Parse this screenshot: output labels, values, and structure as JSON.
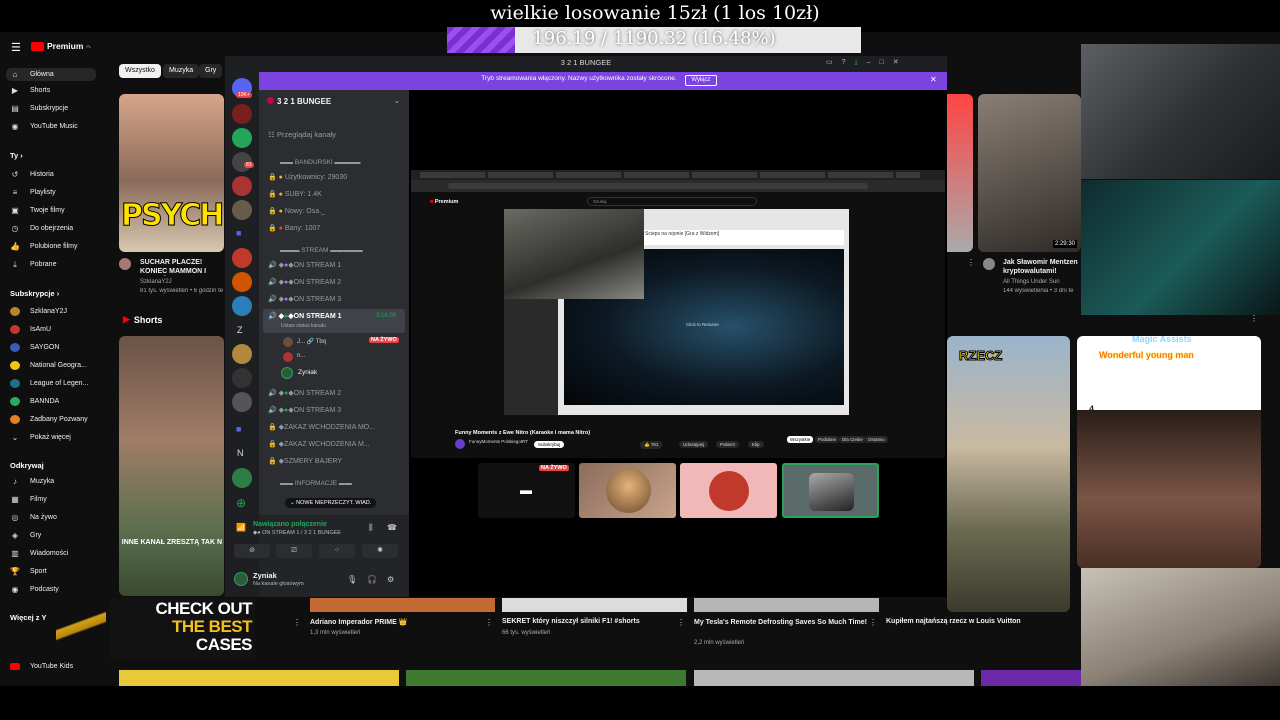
{
  "banner": {
    "title": "wielkie losowanie 15zł (1 los 10zł)",
    "goal_text": "196.19 / 1190.32 (16.48%)",
    "goal_progress": 0.1648
  },
  "youtube": {
    "brand": "Premium",
    "brand_sup": "PL",
    "nav": [
      "Główna",
      "Shorts",
      "Subskrypcje",
      "YouTube Music"
    ],
    "you_header": "Ty",
    "you_items": [
      "Historia",
      "Playlisty",
      "Twoje filmy",
      "Do obejrzenia",
      "Polubione filmy",
      "Pobrane"
    ],
    "subs_header": "Subskrypcje",
    "subs": [
      "SzklanaY2J",
      "IsAmU",
      "SAYGON",
      "National Geogra...",
      "League of Legen...",
      "BANNDA",
      "Zadbany Pozwany",
      "Pokaż więcej"
    ],
    "explore_header": "Odkrywaj",
    "explore": [
      "Muzyka",
      "Filmy",
      "Na żywo",
      "Gry",
      "Wiadomości",
      "Sport",
      "Podcasty"
    ],
    "more_header": "Więcej z Y",
    "more_items": [
      "YouTube Kids"
    ],
    "chips": [
      "Wszystko",
      "Muzyka",
      "Gry"
    ],
    "shorts_label": "Shorts",
    "videos": [
      {
        "title": "SUCHAR PLACZE! KONIEC MAMMON I POWRÓT HON",
        "channel": "SzklanaY2J",
        "meta": "81 tys. wyświetleń • 6 godzin te",
        "thumb_text": "PSYCH"
      },
      {
        "title": "Jak Sławomir Mentzen kryptowalutami!",
        "channel": "All Things Under Sun",
        "meta": "144 wyświetlenia • 3 dni te"
      }
    ],
    "short_thumb_text": "INNE KANAŁ ZRESZTĄ TAK N",
    "bottom_videos": [
      {
        "title": "Adriano Imperador PRIME 👑",
        "meta": "1,3 mln wyświetleń"
      },
      {
        "title": "SEKRET który niszczył silniki F1! #shorts",
        "meta": "66 tys. wyświetleń"
      },
      {
        "title": "My Tesla's Remote Defrosting Saves So Much Time!",
        "meta": "2,2 mln wyświetleń"
      },
      {
        "title": "Kupiłem najtańszą rzecz w Louis Vuitton",
        "meta": ""
      }
    ],
    "short_overlay_rzecz": "RZECZ",
    "magic_title": "Magic Assists",
    "magic_line": "Wonderful young man",
    "magic_count": "4",
    "duration_badge": "2:29:30"
  },
  "discord": {
    "window_title": "3 2 1 BUNGEE",
    "notice": "Tryb streamowania włączony. Nazwy użytkownika zostały skrócone.",
    "notice_button": "Wyłącz",
    "server_name": "3 2 1 BUNGEE",
    "browse": "Przeglądaj kanały",
    "cat_bandurski": "BANDURSKI",
    "info_channels": [
      "Użytkownicy: 29030",
      "SUBY: 1.4K",
      "Nowy: Osa._",
      "Bany: 1007"
    ],
    "cat_stream": "STREAM",
    "stream_channels": [
      "ON STREAM 1",
      "ON STREAM 2",
      "ON STREAM 3"
    ],
    "active_channel": "ON STREAM 1",
    "active_time": "3:16:09",
    "active_status": "Ustaw status kanału",
    "live_badge": "NA ŻYWO",
    "members": [
      "J... 🔗 Tbq",
      "n...",
      "Zyniak"
    ],
    "more_stream": [
      "ON STREAM 2",
      "ON STREAM 3"
    ],
    "locked": [
      "ZAKAZ WCHODZENIA MO...",
      "ZAKAZ WCHODZENIA M...",
      "SZMERY BAJERY"
    ],
    "cat_info": "INFORMACJE",
    "tooltip": "NOWE NIEPRZECZYT. WIAD.",
    "voice_connected": "Nawiązano połączenie",
    "voice_channel": "ON STREAM 1 / 3 2 1 BUNGEE",
    "user_name": "Zyniak",
    "user_status": "Na kanale głosowym",
    "guild_badges": [
      "10K+",
      "83",
      "3",
      "2",
      "1"
    ],
    "guild_letters": [
      "Z",
      "N"
    ],
    "tile_live": "NA ŻYWO"
  },
  "inner_stream": {
    "yt_brand": "Premium",
    "search": "Szukaj",
    "video_title": "Funny Moments z Ewe Nitro (Karaoke i mama Nitro)",
    "channel": "FunnyMoments PolskiegoIRT",
    "subscribe": "Subskrybuj",
    "likes": "761",
    "actions": [
      "Udostępnij",
      "Pobierz",
      "Klip"
    ],
    "overlay_title": "Scieps na rejonie [Gra z Widzem]",
    "click_resume": "Click to Resume",
    "chips": [
      "Wszystkie",
      "Podobne",
      "Dla Ciebie",
      "Ostatnio"
    ]
  },
  "ad": {
    "line1": "CHECK OUT",
    "line2": "THE BEST",
    "line3": "CASES"
  }
}
